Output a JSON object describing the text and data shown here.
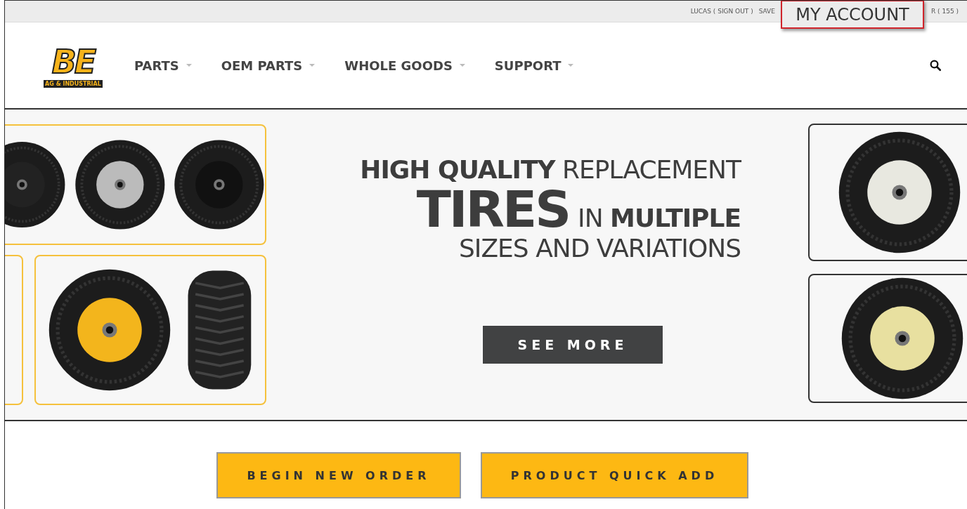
{
  "top_bar": {
    "links": [
      "LUCAS ( SIGN OUT )",
      "SAVE",
      "R ( 155 )"
    ]
  },
  "callout": {
    "label": "MY ACCOUNT"
  },
  "logo": {
    "letters": "BE",
    "tagline": "AG & INDUSTRIAL"
  },
  "nav": [
    {
      "label": "PARTS"
    },
    {
      "label": "OEM PARTS"
    },
    {
      "label": "WHOLE GOODS"
    },
    {
      "label": "SUPPORT"
    }
  ],
  "hero": {
    "lines": [
      {
        "text": "**HIGH QUALITY** REPLACEMENT"
      },
      {
        "lead": "TIRES",
        "text": "IN **MULTIPLE**"
      },
      {
        "text": "SIZES AND VARIATIONS"
      }
    ],
    "button": "SEE MORE"
  },
  "actions": [
    "BEGIN NEW ORDER",
    "PRODUCT QUICK ADD"
  ]
}
